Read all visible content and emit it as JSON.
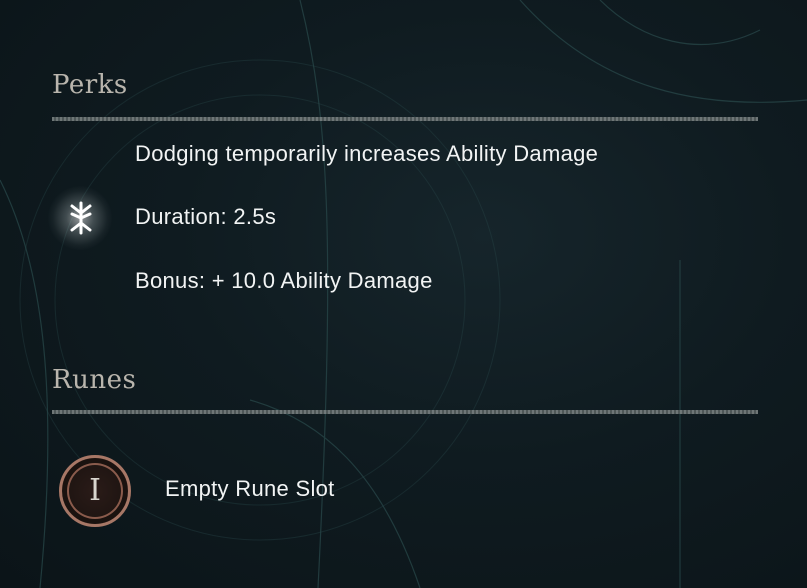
{
  "perks": {
    "title": "Perks",
    "icon": "rune-glyph-icon",
    "lines": [
      "Dodging temporarily increases Ability Damage",
      "Duration: 2.5s",
      "Bonus: + 10.0 Ability Damage"
    ]
  },
  "runes": {
    "title": "Runes",
    "slots": [
      {
        "numeral": "I",
        "label": "Empty Rune Slot"
      }
    ]
  },
  "colors": {
    "background": "#0f1b20",
    "title": "#b9b5ad",
    "text": "#f2f4f4",
    "rune_ring": "#a77766"
  }
}
